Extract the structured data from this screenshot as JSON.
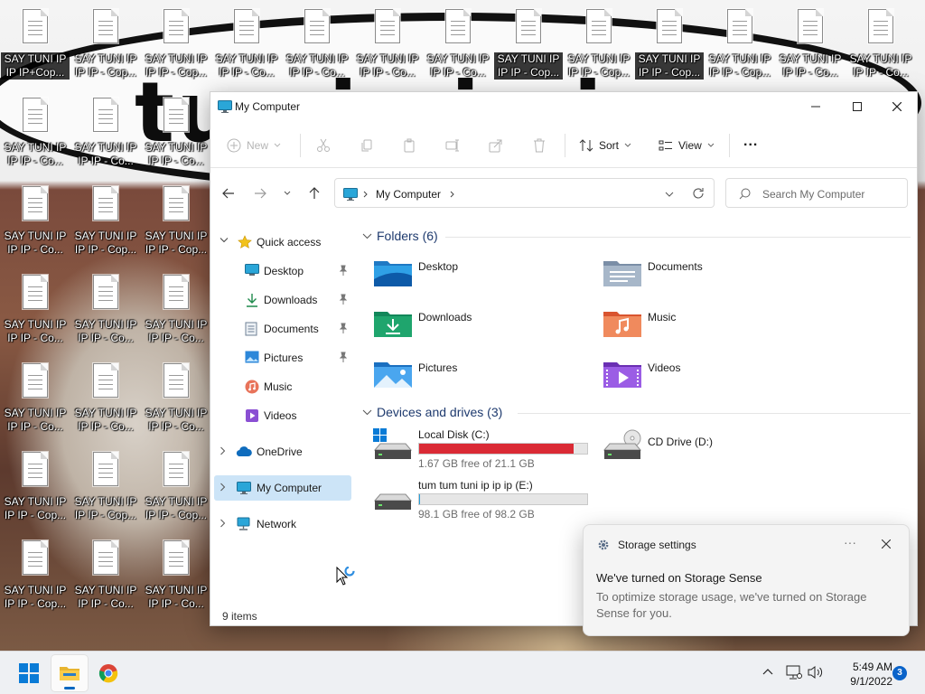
{
  "desktop": {
    "bubble_text": "tun ip ip ip",
    "icons": [
      {
        "label": "SAY TUNI IP IP IP+Cop...",
        "selected": true
      },
      {
        "label": "SAY TUNI IP IP IP - Cop...",
        "selected": false
      },
      {
        "label": "SAY TUNI IP IP IP - Cop...",
        "selected": false
      },
      {
        "label": "SAY TUNI IP IP IP - Co...",
        "selected": false
      },
      {
        "label": "SAY TUNI IP IP IP - Co...",
        "selected": false
      },
      {
        "label": "SAY TUNI IP IP IP - Co...",
        "selected": false
      },
      {
        "label": "SAY TUNI IP IP IP - Co...",
        "selected": false
      },
      {
        "label": "SAY TUNI IP IP IP - Cop...",
        "selected": true
      },
      {
        "label": "SAY TUNI IP IP IP - Cop...",
        "selected": false
      },
      {
        "label": "SAY TUNI IP IP IP - Cop...",
        "selected": true
      },
      {
        "label": "SAY TUNI IP IP IP - Cop...",
        "selected": false
      },
      {
        "label": "SAY TUNI IP IP IP - Co...",
        "selected": false
      },
      {
        "label": "SAY TUNI IP IP IP - Co...",
        "selected": false
      },
      {
        "label": "SAY TUNI IP IP IP - Co...",
        "selected": false
      },
      {
        "label": "SAY TUNI IP IP IP - Co...",
        "selected": false
      },
      {
        "label": "SAY TUNI IP IP IP - Co...",
        "selected": false
      },
      {
        "label": "SAY TUNI IP IP IP - Co...",
        "selected": false
      },
      {
        "label": "SAY TUNI IP IP IP - Cop...",
        "selected": false
      },
      {
        "label": "SAY TUNI IP IP IP - Cop...",
        "selected": false
      },
      {
        "label": "SAY TUNI IP IP IP - Co...",
        "selected": false
      },
      {
        "label": "SAY TUNI IP IP IP - Co...",
        "selected": false
      },
      {
        "label": "SAY TUNI IP IP IP - Co...",
        "selected": false
      },
      {
        "label": "SAY TUNI IP IP IP - Co...",
        "selected": false
      },
      {
        "label": "SAY TUNI IP IP IP - Co...",
        "selected": false
      },
      {
        "label": "SAY TUNI IP IP IP - Co...",
        "selected": false
      },
      {
        "label": "SAY TUNI IP IP IP - Cop...",
        "selected": false
      },
      {
        "label": "SAY TUNI IP IP IP - Cop...",
        "selected": false
      },
      {
        "label": "SAY TUNI IP IP IP - Cop...",
        "selected": false
      },
      {
        "label": "SAY TUNI IP IP IP - Cop...",
        "selected": false
      },
      {
        "label": "SAY TUNI IP IP IP - Co...",
        "selected": false
      },
      {
        "label": "SAY TUNI IP IP IP - Co...",
        "selected": false
      }
    ]
  },
  "window": {
    "title": "My Computer",
    "toolbar": {
      "new_label": "New",
      "sort_label": "Sort",
      "view_label": "View",
      "more_label": "..."
    },
    "address": {
      "location": "My Computer"
    },
    "search": {
      "placeholder": "Search My Computer"
    },
    "sidebar": {
      "quick_access": "Quick access",
      "quick_items": [
        {
          "label": "Desktop",
          "icon": "desktop-folder-icon",
          "pinned": true
        },
        {
          "label": "Downloads",
          "icon": "download-arrow-icon",
          "pinned": true
        },
        {
          "label": "Documents",
          "icon": "document-icon",
          "pinned": true
        },
        {
          "label": "Pictures",
          "icon": "picture-icon",
          "pinned": true
        },
        {
          "label": "Music",
          "icon": "music-icon",
          "pinned": false
        },
        {
          "label": "Videos",
          "icon": "video-icon",
          "pinned": false
        }
      ],
      "onedrive": "OneDrive",
      "my_computer": "My Computer",
      "network": "Network"
    },
    "folders": {
      "header": "Folders (6)",
      "items": [
        {
          "name": "Desktop",
          "icon": "desktop-folder-icon"
        },
        {
          "name": "Documents",
          "icon": "documents-folder-icon"
        },
        {
          "name": "Downloads",
          "icon": "downloads-folder-icon"
        },
        {
          "name": "Music",
          "icon": "music-folder-icon"
        },
        {
          "name": "Pictures",
          "icon": "pictures-folder-icon"
        },
        {
          "name": "Videos",
          "icon": "videos-folder-icon"
        }
      ]
    },
    "drives": {
      "header": "Devices and drives (3)",
      "items": [
        {
          "name": "Local Disk (C:)",
          "free_text": "1.67 GB free of 21.1 GB",
          "used_fraction": 0.92,
          "bar_color": "#da2a35",
          "type": "system-disk"
        },
        {
          "name": "CD Drive (D:)",
          "free_text": "",
          "type": "cd-drive"
        },
        {
          "name": "tum tum tuni ip ip ip (E:)",
          "free_text": "98.1 GB free of 98.2 GB",
          "used_fraction": 0.001,
          "bar_color": "#26a0da",
          "type": "disk"
        }
      ]
    },
    "status": "9 items"
  },
  "toast": {
    "app": "Storage settings",
    "title": "We've turned on Storage Sense",
    "body": "To optimize storage usage, we've turned on Storage Sense for you.",
    "more": "···"
  },
  "taskbar": {
    "time": "5:49 AM",
    "date": "9/1/2022",
    "notifications": "3"
  },
  "colors": {
    "accent": "#0067c0",
    "selection": "#cce4f7",
    "drive_full": "#da2a35"
  }
}
